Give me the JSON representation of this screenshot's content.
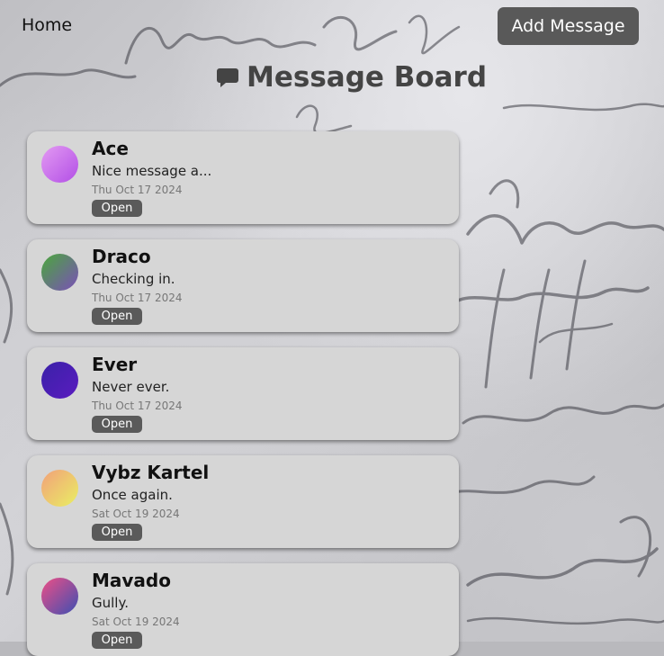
{
  "nav": {
    "home_label": "Home",
    "add_message_label": "Add Message"
  },
  "page": {
    "title": "Message Board",
    "title_icon": "speech-bubble-icon"
  },
  "messages": [
    {
      "name": "Ace",
      "text": "Nice message a...",
      "date": "Thu Oct 17 2024",
      "button_label": "Open",
      "avatar_colors": [
        "#e39af2",
        "#b24fe6"
      ]
    },
    {
      "name": "Draco",
      "text": "Checking in.",
      "date": "Thu Oct 17 2024",
      "button_label": "Open",
      "avatar_colors": [
        "#4aa83b",
        "#7b4fb9"
      ]
    },
    {
      "name": "Ever",
      "text": "Never ever.",
      "date": "Thu Oct 17 2024",
      "button_label": "Open",
      "avatar_colors": [
        "#3a21a8",
        "#5a1cbf"
      ]
    },
    {
      "name": "Vybz Kartel",
      "text": "Once again.",
      "date": "Sat Oct 19 2024",
      "button_label": "Open",
      "avatar_colors": [
        "#f2a07a",
        "#e9ef63"
      ]
    },
    {
      "name": "Mavado",
      "text": "Gully.",
      "date": "Sat Oct 19 2024",
      "button_label": "Open",
      "avatar_colors": [
        "#ee4f86",
        "#3d4fb2"
      ]
    }
  ]
}
